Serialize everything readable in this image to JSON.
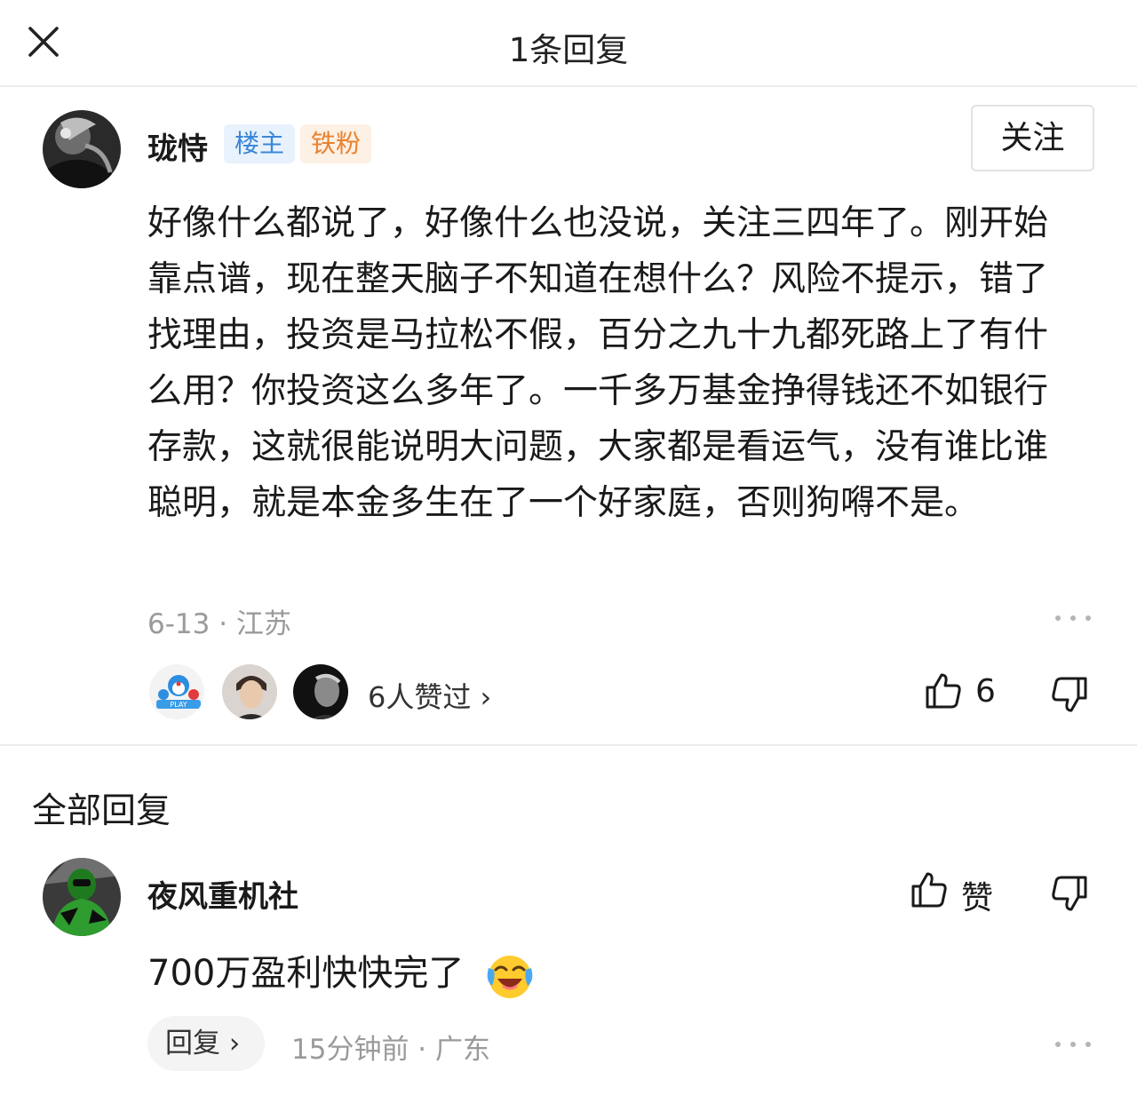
{
  "header": {
    "title": "1条回复"
  },
  "main_comment": {
    "username": "珑恃",
    "badges": [
      "楼主",
      "铁粉"
    ],
    "follow_label": "关注",
    "text": "好像什么都说了，好像什么也没说，关注三四年了。刚开始靠点谱，现在整天脑子不知道在想什么？风险不提示，错了找理由，投资是马拉松不假，百分之九十九都死路上了有什么用？你投资这么多年了。一千多万基金挣得钱还不如银行存款，这就很能说明大问题，大家都是看运气，没有谁比谁聪明，就是本金多生在了一个好家庭，否则狗嘚不是。",
    "meta": "6-13 · 江苏",
    "likers_text": "6人赞过 ›",
    "like_count": "6"
  },
  "section_title": "全部回复",
  "reply": {
    "username": "夜风重机社",
    "like_label": "赞",
    "text": "700万盈利快快完了",
    "emoji": "laughing-crying-emoji",
    "reply_chip": "回复 ›",
    "meta": "15分钟前 · 广东"
  },
  "icons": [
    "close-icon",
    "thumbs-up-icon",
    "thumbs-down-icon",
    "more-icon"
  ],
  "colors": {
    "owner_badge": "#3a86d8",
    "fan_badge": "#e9822f",
    "meta_gray": "#9a9a9a"
  }
}
